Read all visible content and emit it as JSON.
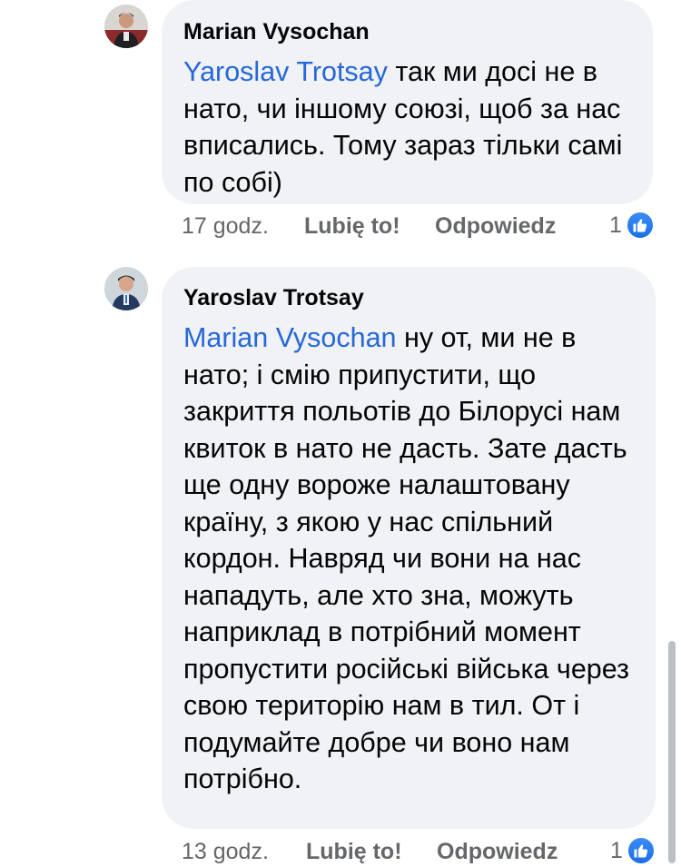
{
  "comments": [
    {
      "author": "Marian Vysochan",
      "mention": "Yaroslav  Trotsay",
      "text": " так ми досі не в нато, чи іншому союзі, щоб за нас вписались. Тому зараз тільки самі по собі)",
      "time": "17 godz.",
      "like_label": "Lubię to!",
      "reply_label": "Odpowiedz",
      "reaction_count": "1",
      "reaction_icon": "thumbs-up-icon"
    },
    {
      "author": "Yaroslav  Trotsay",
      "mention": "Marian Vysochan",
      "text": " ну от, ми не в нато; і смію припустити, що закриття польотів до Білорусі нам квиток в нато не дасть. Зате дасть ще одну вороже налаштовану країну, з якою у нас спільний кордон. Навряд чи вони на нас нападуть, але хто зна, можуть наприклад в потрібний момент пропустити російські війська через свою територію нам в тил. От і подумайте добре чи воно нам потрібно.",
      "time": "13 godz.",
      "like_label": "Lubię to!",
      "reply_label": "Odpowiedz",
      "reaction_count": "1",
      "reaction_icon": "thumbs-up-icon"
    }
  ],
  "colors": {
    "bubble_bg": "#f0f2f5",
    "mention": "#2668d8",
    "meta_text": "#65676b",
    "like_blue": "#1a6fe6"
  }
}
